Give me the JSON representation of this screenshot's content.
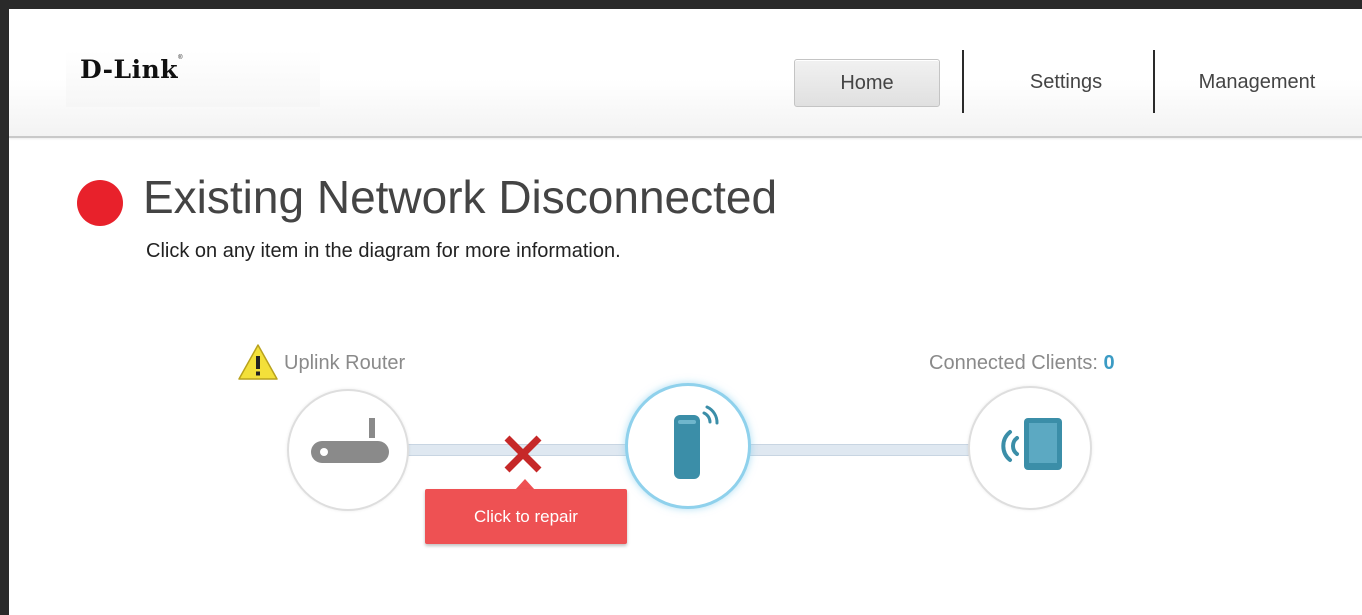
{
  "brand": {
    "logo_text": "D-Link",
    "logo_mark": "®"
  },
  "nav": {
    "items": [
      {
        "label": "Home",
        "active": true
      },
      {
        "label": "Settings",
        "active": false
      },
      {
        "label": "Management",
        "active": false
      }
    ]
  },
  "status": {
    "title": "Existing Network Disconnected",
    "subtitle": "Click on any item in the diagram for more information.",
    "indicator_color": "#e8212b"
  },
  "diagram": {
    "uplink_label": "Uplink Router",
    "uplink_warning_icon": "warning-triangle-icon",
    "router_icon": "router-icon",
    "extender_icon": "extender-device-icon",
    "clients_label": "Connected Clients: ",
    "clients_count": "0",
    "clients_icon": "tablet-wireless-icon",
    "link_status_icon": "disconnected-x-icon",
    "repair_label": "Click to repair",
    "colors": {
      "repair_button": "#ee5153",
      "extender_ring": "#8fd1ec",
      "device_teal": "#3b8ea8",
      "error_x": "#c62828"
    }
  }
}
